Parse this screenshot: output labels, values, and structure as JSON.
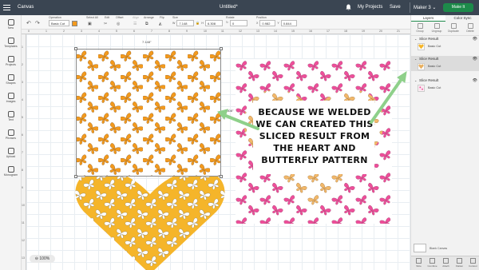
{
  "topbar": {
    "app_title": "Canvas",
    "doc_title": "Untitled*",
    "my_projects": "My Projects",
    "save": "Save",
    "share": "|",
    "machine": "Maker 3",
    "machine_caret": "⌄",
    "make_it": "Make It"
  },
  "toolbar": {
    "undo": "↶",
    "redo": "↷",
    "operation_label": "Operation",
    "operation_value": "Basic Cut",
    "select_all_label": "Select All",
    "edit_label": "Edit",
    "offset_label": "Offset",
    "align_label": "Align",
    "arrange_label": "Arrange",
    "flip_label": "Flip",
    "size_label": "Size",
    "size_w_label": "W",
    "size_w": "7.148",
    "size_h_label": "H",
    "size_h": "6.308",
    "rotate_label": "Rotate",
    "rotate_value": "0",
    "position_label": "Position",
    "pos_x_label": "X",
    "pos_x": "0.982",
    "pos_y_label": "Y",
    "pos_y": "0.844"
  },
  "leftnav": [
    "New",
    "Templates",
    "Projects",
    "Shapes",
    "Images",
    "Text",
    "Phrases",
    "Upload",
    "Monogram"
  ],
  "ruler_top": [
    "0",
    "1",
    "2",
    "3",
    "4",
    "5",
    "6",
    "7",
    "8",
    "9",
    "10",
    "11",
    "12",
    "13",
    "14",
    "15",
    "16",
    "17",
    "18",
    "19",
    "20",
    "21",
    "22"
  ],
  "ruler_left": [
    "1",
    "2",
    "3",
    "4",
    "5",
    "6",
    "7",
    "8",
    "9",
    "10",
    "11",
    "12",
    "13"
  ],
  "canvas": {
    "dim_width": "7.148\"",
    "dim_height": "6.308\"",
    "caption": "BECAUSE WE WELDED WE CAN CREATED THIS SLICED RESULT FROM THE HEART AND BUTTERFLY PATTERN",
    "zoom": "100%"
  },
  "rpanel": {
    "tab_layers": "Layers",
    "tab_color_sync": "Color Sync",
    "icons": [
      "Group",
      "Ungroup",
      "Duplicate",
      "Delete"
    ],
    "groups": [
      {
        "title": "Slice Result",
        "item": "Basic Cut"
      },
      {
        "title": "Slice Result",
        "item": "Basic Cut"
      },
      {
        "title": "Slice Result",
        "item": "Basic Cut"
      }
    ],
    "blank_canvas": "Blank Canvas",
    "bottom": [
      "Slice",
      "Combine",
      "Attach",
      "Flatten",
      "Contour"
    ]
  },
  "colors": {
    "orange": "#f39a1e",
    "yellow": "#f5b52a",
    "pink": "#ee4f9a",
    "arrow_green": "#8ed08a",
    "make_it_green": "#1d8a4a"
  }
}
